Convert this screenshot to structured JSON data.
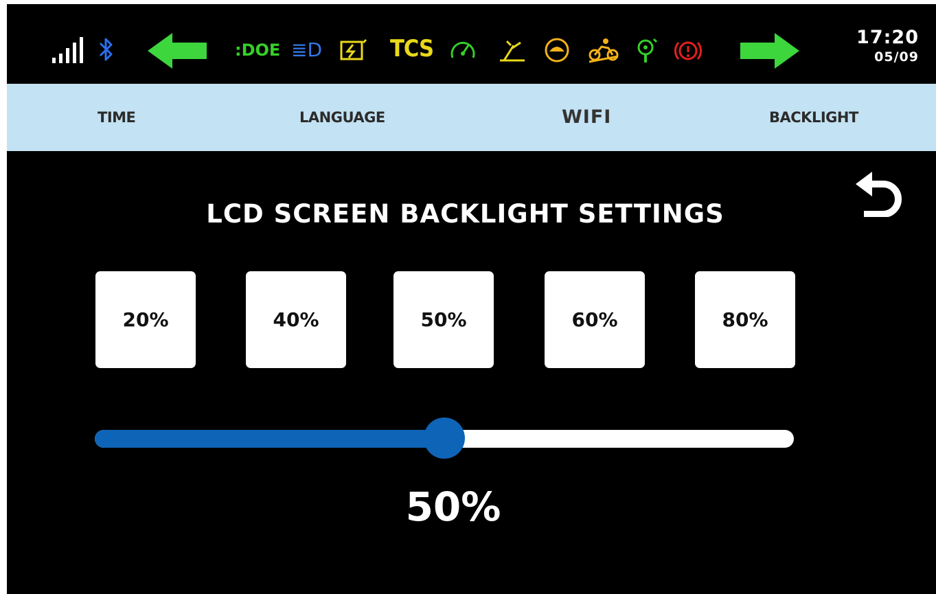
{
  "status_bar": {
    "signal_icon": "signal-strength-icon",
    "bluetooth_icon": "bluetooth-icon",
    "left_arrow_icon": "turn-left-arrow-icon",
    "right_arrow_icon": "turn-right-arrow-icon",
    "indicators": [
      {
        "name": "position-light-icon",
        "glyph": ":DOE",
        "color": "#35d028"
      },
      {
        "name": "high-beam-icon",
        "glyph": "≣D",
        "color": "#3478e8"
      },
      {
        "name": "battery-charge-icon",
        "glyph": "⚡",
        "color": "#e8d91a"
      },
      {
        "name": "engine-oil-icon",
        "glyph": "◔",
        "color": "#35d028"
      },
      {
        "name": "side-stand-icon",
        "glyph": "⚔",
        "color": "#e8d91a"
      },
      {
        "name": "tortoise-mode-icon",
        "glyph": "◑",
        "color": "#f4b21a"
      },
      {
        "name": "motorcycle-icon",
        "glyph": "♞",
        "color": "#f4b21a"
      },
      {
        "name": "service-wrench-icon",
        "glyph": "⚙",
        "color": "#35d028"
      },
      {
        "name": "brake-warning-icon",
        "glyph": "(!)",
        "color": "#e0201e"
      }
    ],
    "tcs_label": "TCS",
    "tcs_color": "#e8d91a",
    "time": "17:20",
    "date": "05/09"
  },
  "tabs": [
    {
      "label": "TIME"
    },
    {
      "label": "LANGUAGE"
    },
    {
      "label": "WIFI"
    },
    {
      "label": "BACKLIGHT"
    }
  ],
  "active_tab": "WIFI",
  "back_icon": "back-arrow-icon",
  "title": "LCD SCREEN BACKLIGHT SETTINGS",
  "presets": [
    {
      "label": "20%"
    },
    {
      "label": "40%"
    },
    {
      "label": "50%"
    },
    {
      "label": "60%"
    },
    {
      "label": "80%"
    }
  ],
  "slider": {
    "value": 0.5,
    "label": "50%"
  },
  "colors": {
    "accent": "#0e64b7",
    "tab_bar": "#c3e2f3",
    "background": "#000000",
    "arrow_green": "#3dd63d"
  }
}
